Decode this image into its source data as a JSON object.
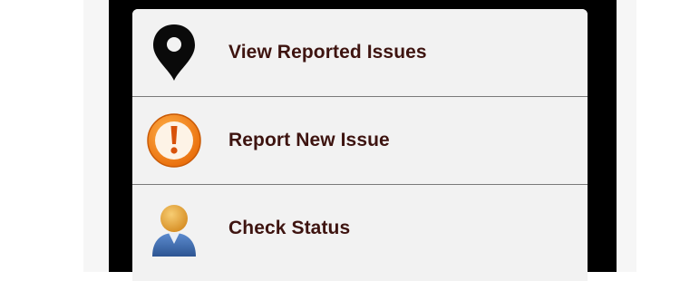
{
  "menu": {
    "items": [
      {
        "label": "View Reported Issues",
        "icon": "map-pin-icon"
      },
      {
        "label": "Report New Issue",
        "icon": "exclamation-alert-icon"
      },
      {
        "label": "Check Status",
        "icon": "user-avatar-icon"
      }
    ]
  },
  "colors": {
    "label_text": "#3e1410",
    "item_background": "#f2f2f2",
    "frame": "#000000",
    "divider": "#7a7a7a",
    "alert_orange": "#f07a10",
    "user_blue": "#3f6fb0",
    "user_skin": "#e5a83e"
  }
}
